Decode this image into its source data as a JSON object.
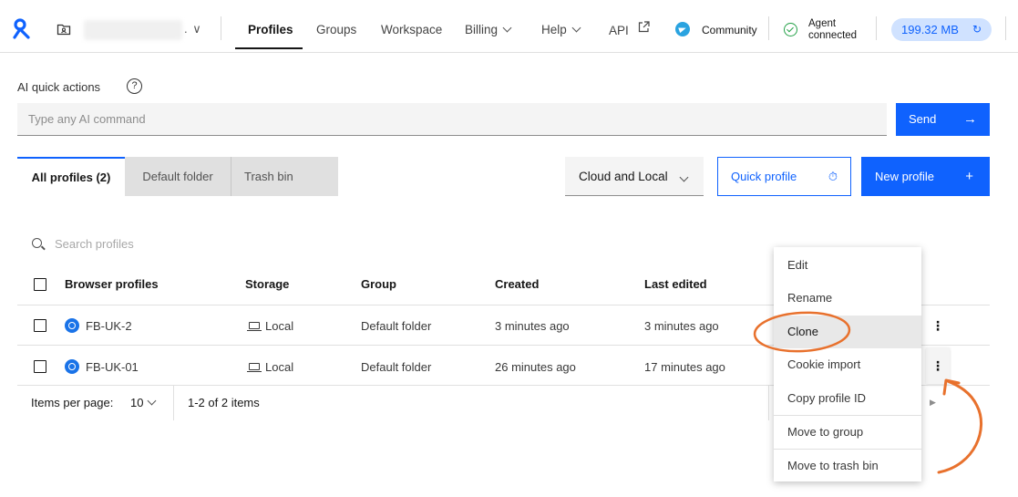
{
  "brand": {
    "accent": "#0f62fe",
    "annotation_color": "#e8712d"
  },
  "topbar": {
    "workspace_caret": ". ∨",
    "nav": [
      {
        "label": "Profiles",
        "active": true
      },
      {
        "label": "Groups"
      },
      {
        "label": "Workspace"
      },
      {
        "label": "Billing"
      },
      {
        "label": "Help"
      },
      {
        "label": "API"
      }
    ],
    "community_label": "Community",
    "agent_status_line1": "Agent",
    "agent_status_line2": "connected",
    "memory_usage": "199.32 MB"
  },
  "ai": {
    "label": "AI quick actions",
    "help_glyph": "?",
    "placeholder": "Type any AI command",
    "send_label": "Send"
  },
  "tabs": [
    {
      "label": "All profiles (2)",
      "active": true
    },
    {
      "label": "Default folder"
    },
    {
      "label": "Trash bin"
    }
  ],
  "toolbar": {
    "filter_value": "Cloud and Local",
    "quick_profile_label": "Quick profile",
    "new_profile_label": "New profile"
  },
  "search": {
    "placeholder": "Search profiles"
  },
  "table": {
    "headers": [
      "Browser profiles",
      "Storage",
      "Group",
      "Created",
      "Last edited"
    ],
    "rows": [
      {
        "name": "FB-UK-2",
        "storage": "Local",
        "group": "Default folder",
        "created": "3 minutes ago",
        "edited": "3 minutes ago"
      },
      {
        "name": "FB-UK-01",
        "storage": "Local",
        "group": "Default folder",
        "created": "26 minutes ago",
        "edited": "17 minutes ago"
      }
    ]
  },
  "pagination": {
    "items_per_page_label": "Items per page:",
    "items_per_page_value": "10",
    "range_text": "1-2 of 2 items"
  },
  "context_menu": {
    "items": [
      {
        "label": "Edit"
      },
      {
        "label": "Rename"
      },
      {
        "label": "Clone",
        "highlighted": true
      },
      {
        "label": "Cookie import"
      },
      {
        "label": "Copy profile ID"
      },
      {
        "label": "Move to group"
      },
      {
        "label": "Move to trash bin"
      }
    ]
  }
}
